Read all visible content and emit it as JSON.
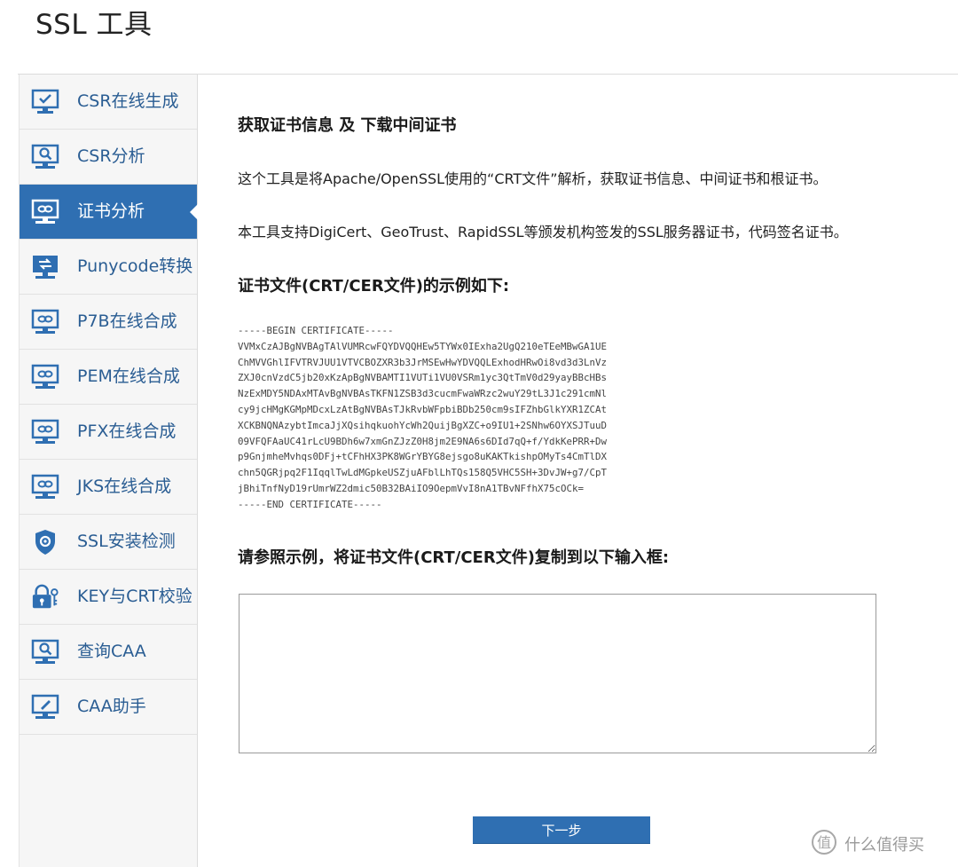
{
  "page": {
    "title": "SSL 工具"
  },
  "sidebar": {
    "items": [
      {
        "label": "CSR在线生成",
        "icon": "monitor-check-icon",
        "active": false
      },
      {
        "label": "CSR分析",
        "icon": "monitor-search-icon",
        "active": false
      },
      {
        "label": "证书分析",
        "icon": "monitor-link-icon",
        "active": true
      },
      {
        "label": "Punycode转换",
        "icon": "monitor-convert-icon",
        "active": false
      },
      {
        "label": "P7B在线合成",
        "icon": "monitor-link-icon",
        "active": false
      },
      {
        "label": "PEM在线合成",
        "icon": "monitor-link-icon",
        "active": false
      },
      {
        "label": "PFX在线合成",
        "icon": "monitor-link-icon",
        "active": false
      },
      {
        "label": "JKS在线合成",
        "icon": "monitor-link-icon",
        "active": false
      },
      {
        "label": "SSL安装检测",
        "icon": "shield-gear-icon",
        "active": false
      },
      {
        "label": "KEY与CRT校验",
        "icon": "lock-key-icon",
        "active": false
      },
      {
        "label": "查询CAA",
        "icon": "monitor-search-icon",
        "active": false
      },
      {
        "label": "CAA助手",
        "icon": "monitor-pen-icon",
        "active": false
      }
    ]
  },
  "main": {
    "heading": "获取证书信息 及 下载中间证书",
    "intro_1": "这个工具是将Apache/OpenSSL使用的“CRT文件”解析，获取证书信息、中间证书和根证书。",
    "intro_2": "本工具支持DigiCert、GeoTrust、RapidSSL等颁发机构签发的SSL服务器证书，代码签名证书。",
    "example_heading": "证书文件(CRT/CER文件)的示例如下:",
    "example_cert": "-----BEGIN CERTIFICATE-----\nVVMxCzAJBgNVBAgTAlVUMRcwFQYDVQQHEw5TYWx0IExha2UgQ210eTEeMBwGA1UE\nChMVVGhlIFVTRVJUU1VTVCBOZXR3b3JrMSEwHwYDVQQLExhodHRwOi8vd3d3LnVz\nZXJ0cnVzdC5jb20xKzApBgNVBAMTI1VUTi1VU0VSRm1yc3QtTmV0d29yayBBcHBs\nNzExMDY5NDAxMTAvBgNVBAsTKFN1ZSB3d3cucmFwaWRzc2wuY29tL3J1c291cmNl\ncy9jcHMgKGMpMDcxLzAtBgNVBAsTJkRvbWFpbiBDb250cm9sIFZhbGlkYXR1ZCAt\nXCKBNQNAzybtImcaJjXQsihqkuohYcWh2QuijBgXZC+o9IU1+2SNhw6OYXSJTuuD\n09VFQFAaUC41rLcU9BDh6w7xmGnZJzZ0H8jm2E9NA6s6DId7qQ+f/YdkKePRR+Dw\np9GnjmheMvhqs0DFj+tCFhHX3PK8WGrYBYG8ejsgo8uKAKTkishpOMyTs4CmTlDX\nchn5QGRjpq2F1IqqlTwLdMGpkeUSZjuAFblLhTQs158Q5VHC5SH+3DvJW+g7/CpT\njBhiTnfNyD19rUmrWZ2dmic50B32BAiIO9OepmVvI8nA1TBvNFfhX75cOCk=\n-----END CERTIFICATE-----",
    "input_heading": "请参照示例，将证书文件(CRT/CER文件)复制到以下输入框:",
    "input_value": "",
    "next_label": "下一步"
  },
  "watermark": {
    "text": "什么值得买",
    "icon": "zhi-icon"
  },
  "colors": {
    "accent": "#2f6fb2",
    "link": "#2a5d93",
    "sidebar_bg": "#f6f6f6"
  }
}
